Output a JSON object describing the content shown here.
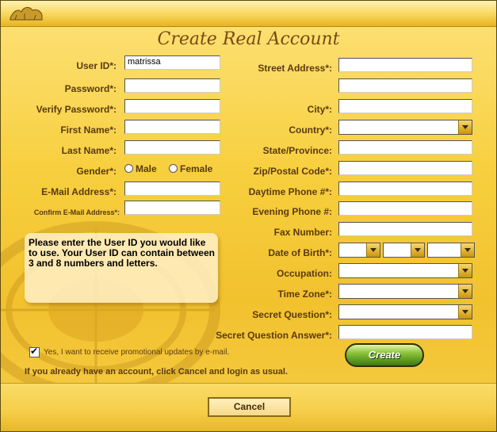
{
  "window": {
    "title": "Create Real Account"
  },
  "logo": {
    "icon": "lion-logo-icon"
  },
  "left_fields": [
    {
      "label": "User ID*:",
      "value": "matrissa",
      "name": "user-id-input"
    },
    {
      "label": "Password*:",
      "value": "",
      "name": "password-input"
    },
    {
      "label": "Verify Password*:",
      "value": "",
      "name": "verify-password-input"
    },
    {
      "label": "First Name*:",
      "value": "",
      "name": "first-name-input"
    },
    {
      "label": "Last Name*:",
      "value": "",
      "name": "last-name-input"
    }
  ],
  "gender": {
    "label": "Gender*:",
    "male": "Male",
    "female": "Female"
  },
  "email": {
    "label": "E-Mail Address*:",
    "value": ""
  },
  "confirm_email": {
    "label": "Confirm E-Mail Address*:",
    "value": ""
  },
  "right_fields": {
    "street": "Street Address*:",
    "city": "City*:",
    "country": "Country*:",
    "state": "State/Province:",
    "zip": "Zip/Postal Code*:",
    "day_phone": "Daytime Phone #*:",
    "eve_phone": "Evening Phone #:",
    "fax": "Fax Number:",
    "dob": "Date of Birth*:",
    "occupation": "Occupation:",
    "timezone": "Time Zone*:",
    "secret_q": "Secret Question*:",
    "secret_a": "Secret Question Answer*:"
  },
  "hint": "Please enter the User ID you would like to use. Your User ID can contain between 3 and 8 numbers and letters.",
  "promo_checkbox": {
    "label": "Yes, I want to receive promotional updates by e-mail.",
    "checked": true
  },
  "already_text": "If you already have an account, click Cancel and login as usual.",
  "buttons": {
    "create": "Create",
    "cancel": "Cancel"
  },
  "colors": {
    "background": "#f2c12e",
    "label": "#5a3a10",
    "title": "#7a4a14",
    "create": "#3b7a12"
  }
}
